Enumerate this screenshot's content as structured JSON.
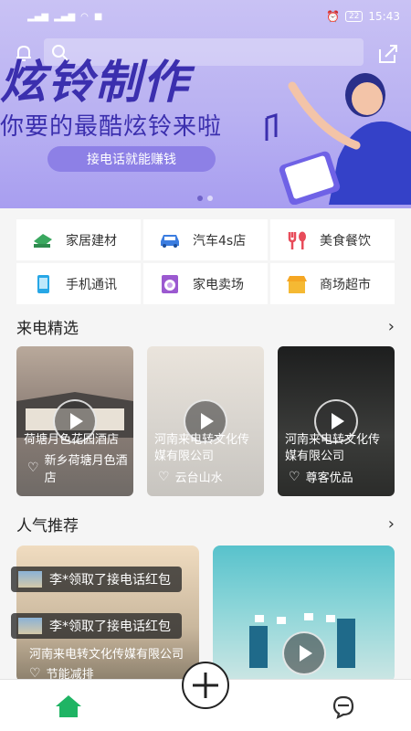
{
  "status_bar": {
    "time": "15:43",
    "battery": "22",
    "left_icons": [
      "HD",
      "4G",
      "HD",
      "wifi-icon",
      "phone-icon",
      "shield-icon",
      "mail-icon"
    ]
  },
  "banner": {
    "title": "炫铃制作",
    "subtitle": "你要的最酷炫铃来啦",
    "button": "接电话就能赚钱",
    "page_indicator": {
      "count": 2,
      "active": 0
    }
  },
  "categories": [
    {
      "label": "家居建材",
      "icon": "home-materials-icon",
      "color": "#3aa85f"
    },
    {
      "label": "汽车4s店",
      "icon": "car-icon",
      "color": "#3b7de0"
    },
    {
      "label": "美食餐饮",
      "icon": "food-icon",
      "color": "#e84c5a"
    },
    {
      "label": "手机通讯",
      "icon": "phone-icon",
      "color": "#27a7e6"
    },
    {
      "label": "家电卖场",
      "icon": "washer-icon",
      "color": "#9b59d0"
    },
    {
      "label": "商场超市",
      "icon": "shop-icon",
      "color": "#f5b933"
    }
  ],
  "sections": {
    "featured": {
      "title": "来电精选",
      "arrow": "›"
    },
    "popular": {
      "title": "人气推荐",
      "arrow": "›"
    }
  },
  "featured_cards": [
    {
      "title": "荷塘月色花园酒店",
      "footer": "新乡荷塘月色酒店"
    },
    {
      "title": "河南来电转文化传媒有限公司",
      "footer": "云台山水"
    },
    {
      "title": "河南来电转文化传媒有限公司",
      "footer": "尊客优品"
    }
  ],
  "popular_cards": [
    {
      "title": "河南来电转文化传媒有限公司",
      "footer": "节能减排"
    },
    {
      "title": "",
      "footer": ""
    }
  ],
  "toasts": [
    {
      "text": "李*领取了接电话红包"
    },
    {
      "text": "李*领取了接电话红包"
    }
  ]
}
